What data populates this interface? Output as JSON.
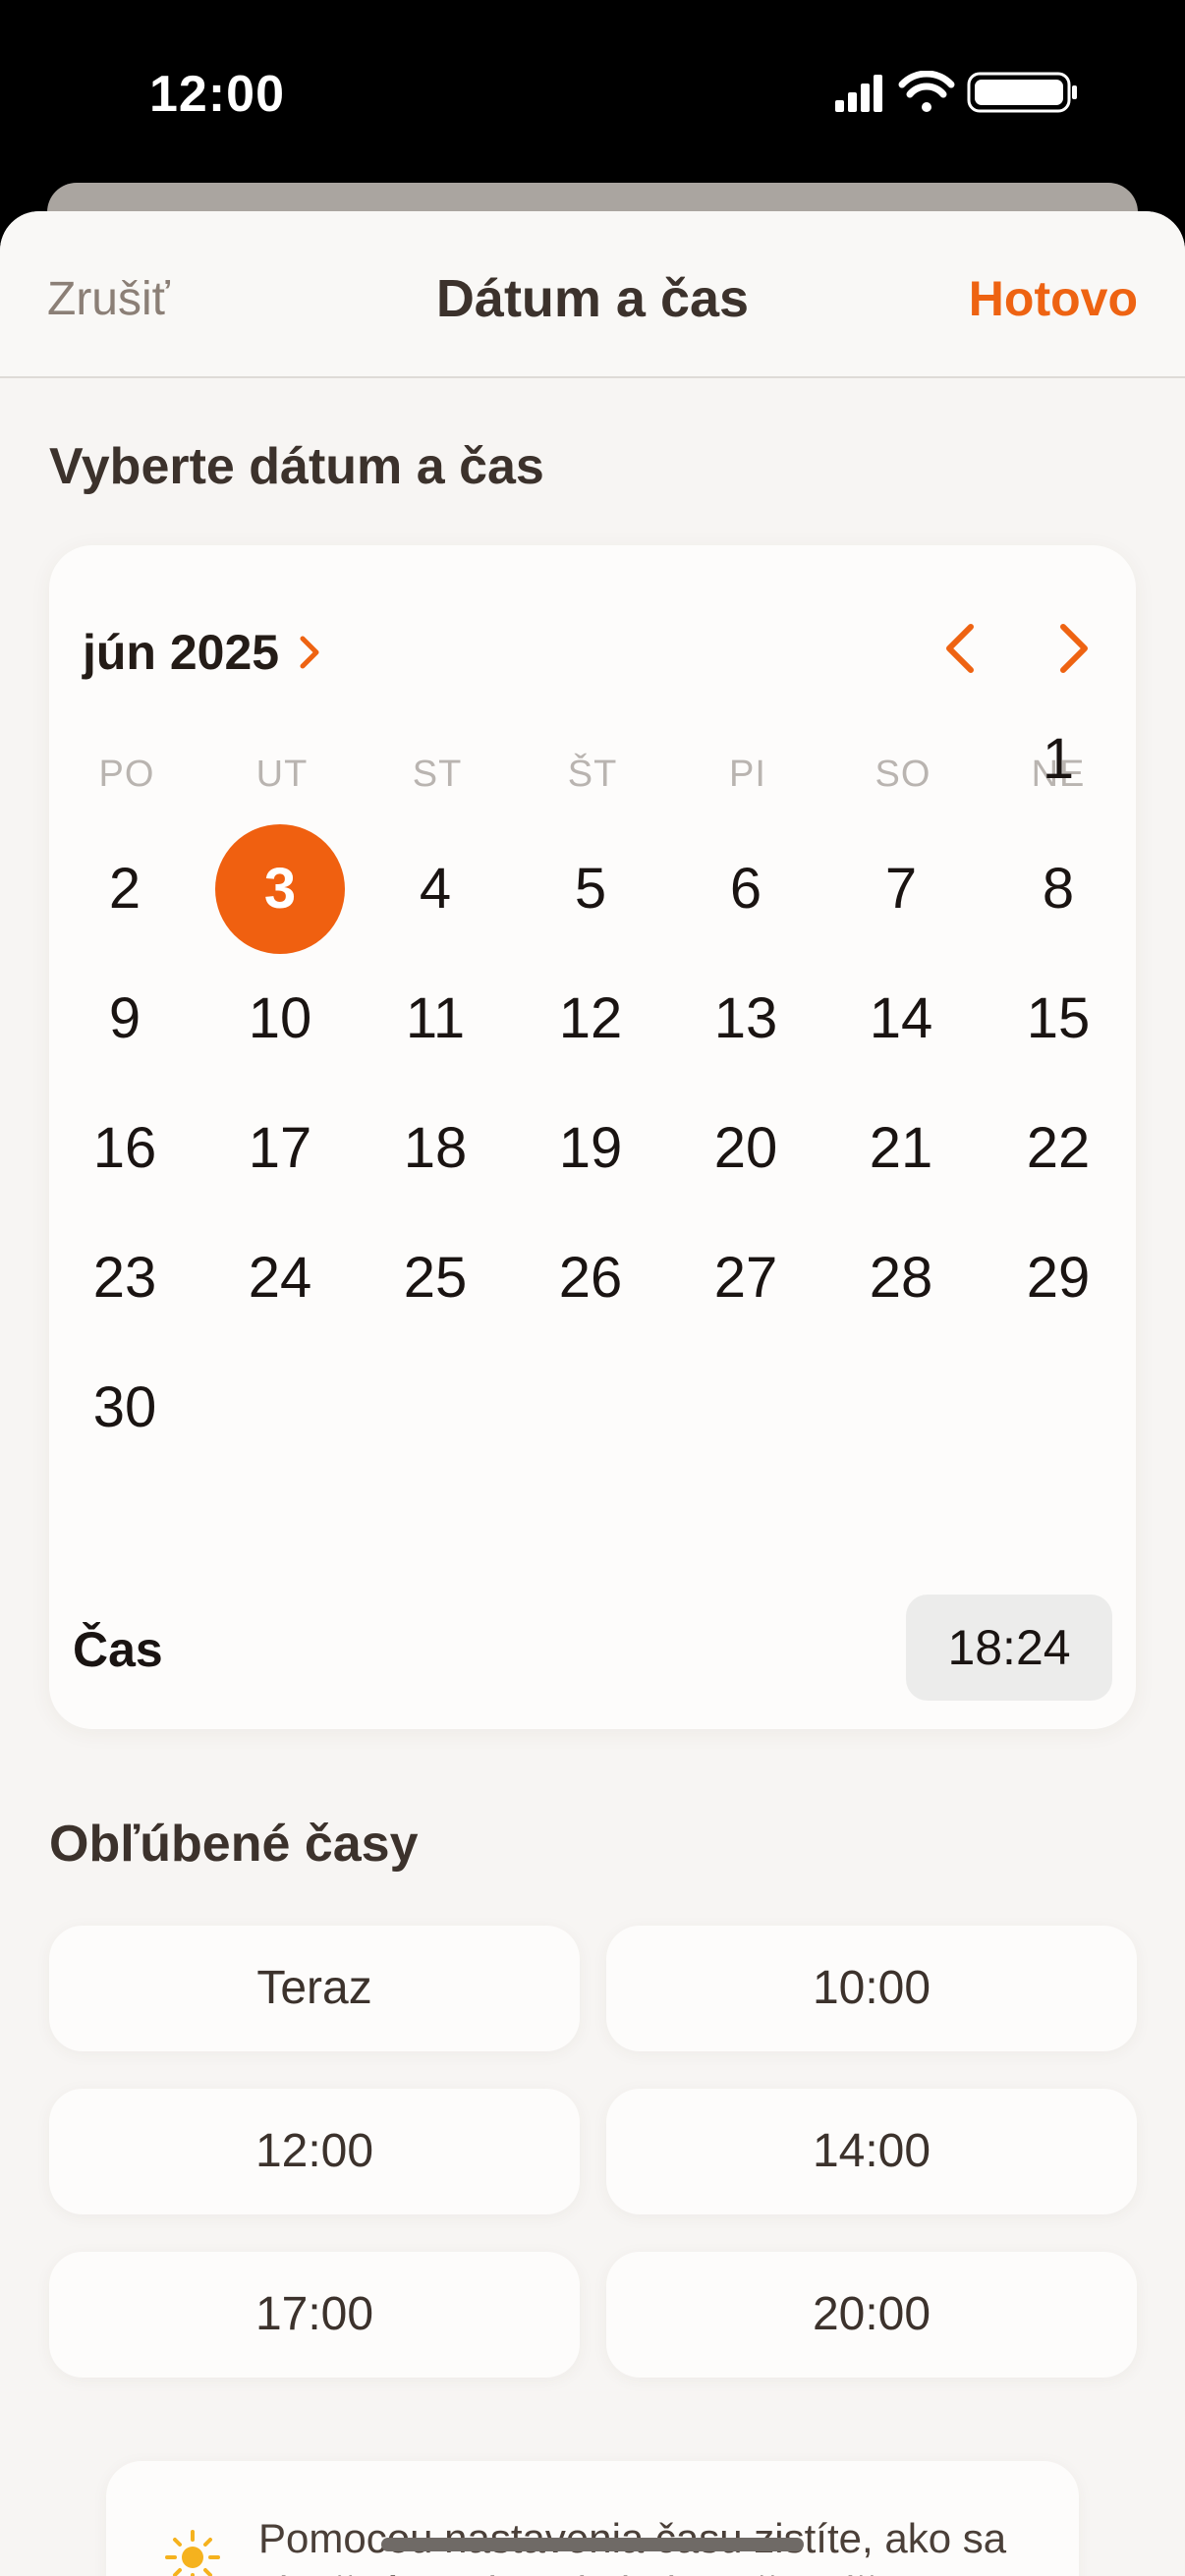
{
  "status_bar": {
    "time": "12:00"
  },
  "nav": {
    "cancel": "Zrušiť",
    "title": "Dátum a čas",
    "done": "Hotovo"
  },
  "picker": {
    "section_title": "Vyberte dátum a čas",
    "month_label": "jún 2025",
    "weekdays": [
      "PO",
      "UT",
      "ST",
      "ŠT",
      "PI",
      "SO",
      "NE"
    ],
    "days": [
      "1",
      "2",
      "3",
      "4",
      "5",
      "6",
      "7",
      "8",
      "9",
      "10",
      "11",
      "12",
      "13",
      "14",
      "15",
      "16",
      "17",
      "18",
      "19",
      "20",
      "21",
      "22",
      "23",
      "24",
      "25",
      "26",
      "27",
      "28",
      "29",
      "30"
    ],
    "selected_day": "3",
    "time_label": "Čas",
    "time_value": "18:24"
  },
  "favorites": {
    "title": "Obľúbené časy",
    "items": [
      "Teraz",
      "10:00",
      "12:00",
      "14:00",
      "17:00",
      "20:00"
    ]
  },
  "tip": {
    "text": "Pomocou nastavenia času zistíte, ako sa slnečné svetlo pohybuje počas dňa."
  },
  "colors": {
    "accent": "#f06010",
    "background": "#f7f5f3",
    "card": "#fdfcfb"
  },
  "icons": {
    "sun": "sun-icon",
    "chevron_right": "chevron-right-icon",
    "chevron_left": "chevron-left-icon"
  }
}
